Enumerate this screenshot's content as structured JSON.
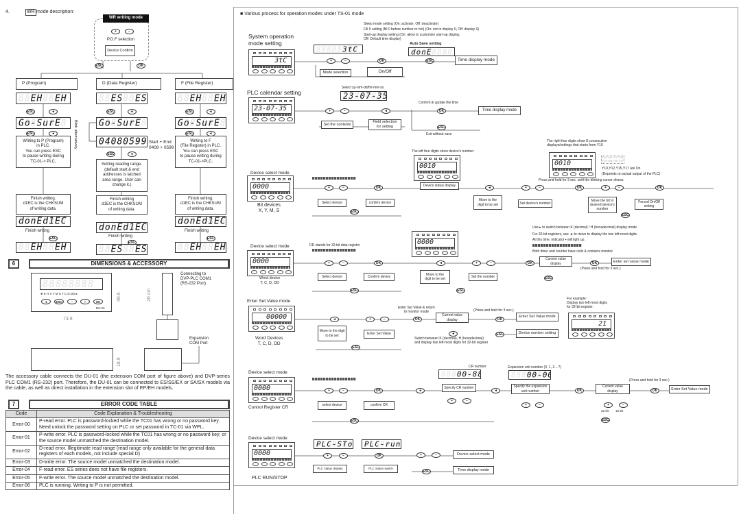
{
  "left": {
    "section_num": "4.",
    "wr_tag": "WR",
    "wr_desc": "mode description:",
    "wr_mode": "WR writing mode",
    "pdf_selection": "P.D.F selection",
    "device_confirm": "Device Confirm",
    "blink": "Blink alternatively",
    "p": {
      "title": "P (Program)",
      "disp1": "  EH  EH",
      "disp2": "Go-SurE",
      "writing": "Writing to P (Program)\nin PLC.\nYou can press ESC\nto pause writing during\nTC-01-> PLC.",
      "finish": "Finish writing.\nd1EC is the CHKSUM\nof writing data.",
      "done": "donEd1EC",
      "finish_label": "Finish writing",
      "disp_end": "  EH  EH"
    },
    "d": {
      "title": "D (Data Register)",
      "disp1": "  ES  ES",
      "disp2": "Go-SurE",
      "disp3": "04080599",
      "start_end": "Start + End\n0408 + 0599",
      "setting": "Setting reading range.\n(default start & end\naddresses is latched\narea range. User can\nchange it.)",
      "finish": "Finish writing\nd1EC is the CHKSUM\nof writing data.",
      "done": "donEd1EC",
      "finish_label": "Finish writing",
      "disp_end": "  ES  ES"
    },
    "f": {
      "title": "F (File Register)",
      "disp1": "  EH  EH",
      "disp2": "Go-SurE",
      "writing": "Writing to F\n(File Register) in PLC.\nYou can press ESC\nto pause writing during\nTC-01->PLC.",
      "finish": "Finish writing.\nd1EC is the CHKSUM\nof writing data.",
      "done": "donEd1EC",
      "finish_label": "Finish writing",
      "disp_end": "  EH  EH"
    }
  },
  "buttons": {
    "esc": "ESC",
    "ok": "OK",
    "plus": "+",
    "minus": "−",
    "left": "◄"
  },
  "dims": {
    "num": "6",
    "title": "DIMENSIONS & ACCESSORY",
    "indicators": "◄ K H X Y M S T C D DD ▸",
    "keys": [
      "◄",
      "ESC",
      "−",
      "+",
      "OK"
    ],
    "model": "DU-01",
    "width": "73.8",
    "height": "40.6",
    "depth": "18.9",
    "cable": "20 cm",
    "connect": "Connecting to\nDVP-PLC COM1\n(RS-232 Port)",
    "expansion": "Expansion\nCOM Port",
    "paragraph": "The accessory cable connects the DU-01 (the extension COM port of figure above) and DVP-series PLC COM1 (RS-232) port.  Therefore, the DU-01 can be connected to ES/SS/EX or SA/SX models via the cable, as well as direct installation in the extension slot of EP/EH models."
  },
  "errors": {
    "num": "7",
    "title": "ERROR CODE TABLE",
    "headers": [
      "Code",
      "Code Explanation & Troubleshooting"
    ],
    "rows": [
      {
        "code": "Error-00",
        "text": "P-read error. PLC is password-locked while the TC01 has wrong or no password key. Need unlock the password setting on PLC or set password in TC-01 via WPL."
      },
      {
        "code": "Error-01",
        "text": "P-write error. PLC is password-locked while the TC01 has wrong or no password key; or the source model unmatched the destination model."
      },
      {
        "code": "Error-02",
        "text": "D-read error. Illegitimate read range (read range only available for the general data registers of each models, not include special D)"
      },
      {
        "code": "Error-03",
        "text": "D-write error. The source model unmatched the destination model."
      },
      {
        "code": "Error-04",
        "text": "F-read error. ES series does not have file registers."
      },
      {
        "code": "Error-05",
        "text": "F-write error. The source model unmatched the destination model."
      },
      {
        "code": "Error-06",
        "text": "PLC is running. Writing to P is not permitted."
      }
    ]
  },
  "right": {
    "heading": "■   Various process for operation modes under TS-01 mode",
    "sys": {
      "title": "System operation\nmode setting",
      "panel": "     3tC ",
      "sleep": "Sleep mode setting    (On: activate, Off: deactivate)",
      "fill": "Fill 0 setting (fill 0 before number or not)  (On: not to display 0, Off: display 0)",
      "startup": "Start-up display setting (On: allow to customize start-up display,\n                                         Off: Default time display)",
      "auto_save": "Auto Save setting",
      "done": "donE",
      "mode_selection": "Mode selection",
      "on_off": "On/Off",
      "time_display": "Time display mode"
    },
    "cal": {
      "title": "PLC calendar setting",
      "panel": "23-07-35",
      "select": "Select yy-mm-dd/hh-mm-ss",
      "disp": "23-07-35",
      "confirm": "Confirm & update the time",
      "time_display": "Time display mode",
      "set_contents": "Set the contents",
      "field": "Field selection\nfor setting",
      "exit": "Exit without save"
    },
    "bit": {
      "title": "Device select mode",
      "panel": "0000",
      "caption": "Bit devices\nX, Y, M, S",
      "left_four": "The left four digits show device's number",
      "status_panel": "0010",
      "select": "Select device",
      "confirm": "confirm device",
      "status": "Device status display",
      "move": "Move to the\ndigit to be set",
      "set_number": "Set device's number",
      "right_four": "The right four digits show 8 consecutive\ndisplays/settings that starts from Y10",
      "right_panel": "0010",
      "y_grid": "Y10 Y11 Y12 Y13\nY14 Y15 Y16 Y17",
      "y_on": "Y10,Y12,Y15,Y17 are On",
      "depends": "(Depends on actual output of the PLC)",
      "hold": "Press and hold for 3 sec. until the blinking cursor shows.",
      "move_bit": "Move the bit to\ndesired device's\nnumber",
      "forced": "Forced On/Off\nsetting"
    },
    "word": {
      "title": "Device select mode",
      "panel": "0000",
      "caption": "Word device\nT, C, D, DD",
      "dd_note": "DD stands for 32-bit data register",
      "mid_panel": "0000",
      "select": "Select device",
      "confirm": "Confirm device",
      "move": "Move to the\ndigit to be set",
      "set_number": "Set the number",
      "note1": "Use ▸ to switch between K (decimal) / H (hexadecimal) display mode.",
      "note2": "For 32-bit registers, use ◄ to move to display the two left-most digits.",
      "note3": "At this time, indicator ▪ will light up.",
      "note4": "Both timer and counter have coils & contacts monitor.",
      "current": "Current value\ndisplay",
      "enter": "Enter set value mode",
      "hold": "(Press and hold for 3 sec.)"
    },
    "setval": {
      "title": "Enter Set Value mode",
      "panel": "   00000",
      "caption": "Word Devices\nT, C, D, DD",
      "move": "Move to the digit\nto be set",
      "enter_value": "Enter Set Value",
      "return": "Enter Set Value & return\nto monitor mode",
      "current": "Current value\ndisplay",
      "switch": "Switch between K (decimal), H (hexadecimal)\nand display two left-most digits for 32-bit register",
      "hold": "(Press and hold for 3 sec.)",
      "enter_mode": "Enter Set Value mode",
      "device_number": "Device number setting",
      "example": "For example:\nDisplay two left-most digits\nfor 32-bit register:",
      "example_panel": "      21"
    },
    "cr": {
      "title": "Device select mode",
      "panel": "0000",
      "caption": "Control Register CR",
      "select": "select device",
      "confirm": "confirm CR",
      "cr_number": "CR number",
      "cr_disp": "   00-88",
      "specify": "Specify CR number",
      "exp_number": "Expansion unit number (0, 1, 2... 7)",
      "exp_disp": "   00-00",
      "specify_exp": "Specify the expansion\nunit number",
      "current": "Current value\ndisplay",
      "bit32": "32-bit",
      "bit16": "16-bit",
      "hold": "(Press and hold for 3 sec.)",
      "enter_mode": "Enter Set Value mode"
    },
    "run": {
      "title": "Device select mode",
      "panel": "0000",
      "caption": "PLC RUN/STOP",
      "stop": "PLC-SToP",
      "runv": "PLC-run",
      "status_display": "PLC status display",
      "status_switch": "PLC status switch",
      "device_select": "Device select mode",
      "time_display": "Time display mode"
    }
  }
}
